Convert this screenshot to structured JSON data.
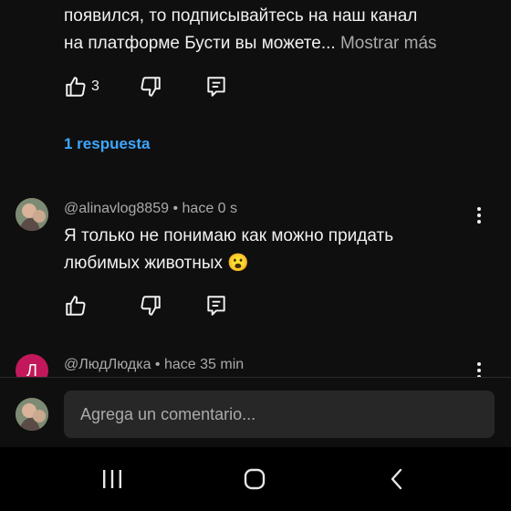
{
  "comment_top": {
    "line1": "появился, то подписывайтесь  на наш канал",
    "line2": "на платформе Бусти вы можете...",
    "more_label": "Mostrar más",
    "likes": "3",
    "replies_label": "1 respuesta"
  },
  "comment_two": {
    "author": "@alinavlog8859",
    "time": "hace 0 s",
    "line1": "Я только не понимаю как можно придать",
    "line2": "любимых животных",
    "emoji": "😮"
  },
  "comment_three": {
    "avatar_letter": "Л",
    "author": "@ЛюдЛюдка",
    "time": "hace 35 min"
  },
  "composer": {
    "placeholder": "Agrega un comentario..."
  },
  "colors": {
    "background": "#0f0f0f",
    "link": "#3ea6ff",
    "avatar_letter_bg": "#c2185b"
  },
  "icons": [
    "like-icon",
    "dislike-icon",
    "reply-icon",
    "more-vert-icon",
    "recents-icon",
    "home-icon",
    "back-icon"
  ]
}
